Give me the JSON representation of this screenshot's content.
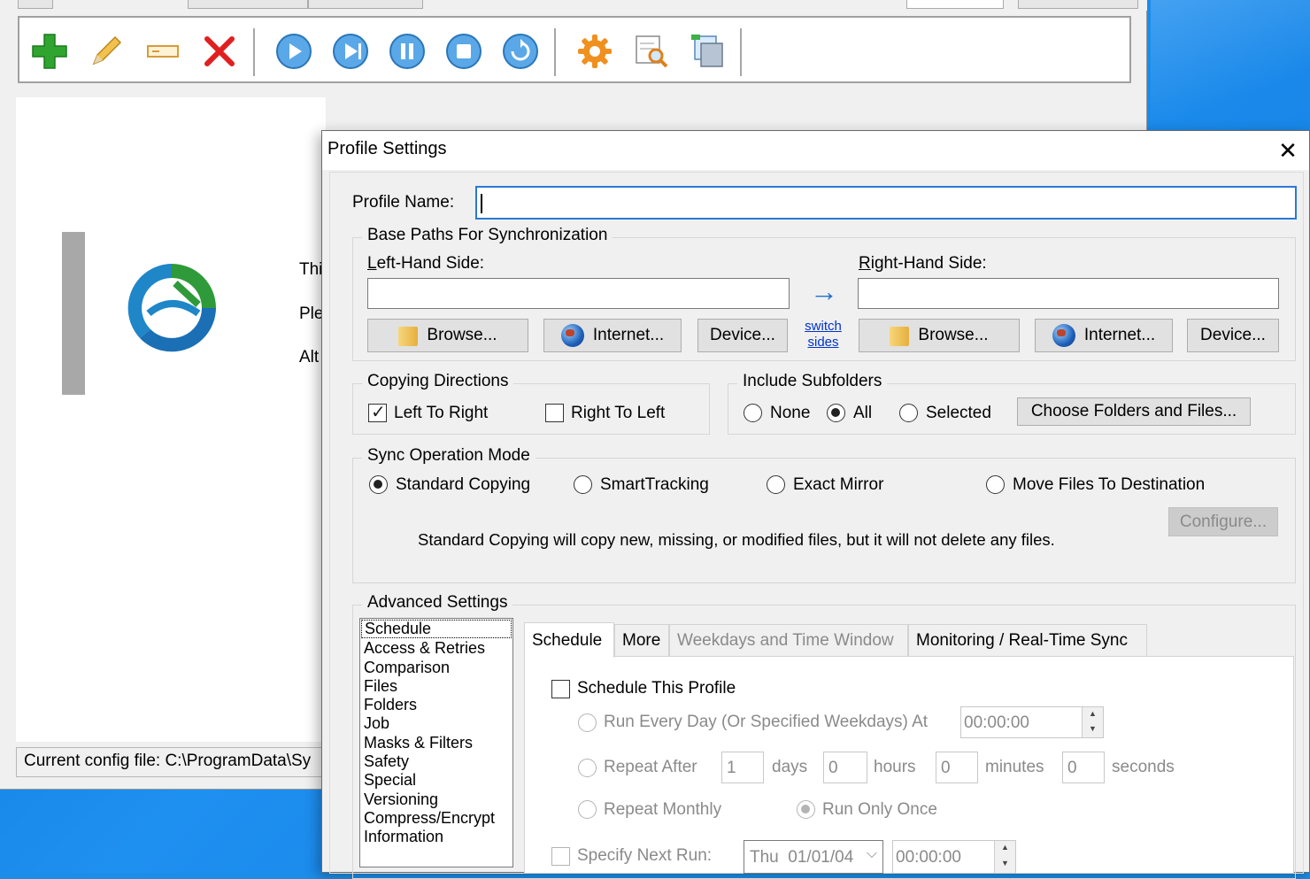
{
  "status": {
    "config_file": "Current config file: C:\\ProgramData\\Sy"
  },
  "background_text": {
    "line1": "Thi",
    "line2": "Ple",
    "line3": "Alt"
  },
  "toolbar": {
    "icons": [
      "add-icon",
      "edit-icon",
      "rename-icon",
      "delete-icon",
      "run-icon",
      "run-attended-icon",
      "pause-icon",
      "stop-icon",
      "restore-icon",
      "settings-icon",
      "analyze-icon",
      "copy-profile-icon"
    ]
  },
  "dialog": {
    "title": "Profile Settings",
    "close_glyph": "✕",
    "profile_name_label": "Profile Name:",
    "profile_name_value": "",
    "base_paths": {
      "title": "Base Paths For Synchronization",
      "left_label_mnemonic": "L",
      "left_label_rest": "eft-Hand Side:",
      "right_label_mnemonic": "R",
      "right_label_rest": "ight-Hand Side:",
      "left_value": "",
      "right_value": "",
      "browse": "Browse...",
      "internet": "Internet...",
      "device": "Device...",
      "arrow": "→",
      "switch_line1": "switch",
      "switch_line2": "sides"
    },
    "copying_directions": {
      "title": "Copying Directions",
      "left_to_right": "Left To Right",
      "left_to_right_checked": true,
      "right_to_left": "Right To Left",
      "right_to_left_checked": false
    },
    "subfolders": {
      "title": "Include Subfolders",
      "options": [
        "None",
        "All",
        "Selected"
      ],
      "selected": "All",
      "choose_button": "Choose Folders and Files..."
    },
    "sync_mode": {
      "title": "Sync Operation Mode",
      "options": [
        "Standard Copying",
        "SmartTracking",
        "Exact Mirror",
        "Move Files To Destination"
      ],
      "selected": "Standard Copying",
      "configure_button": "Configure...",
      "description": "Standard Copying will copy new, missing, or modified files, but it will not delete any files."
    },
    "advanced": {
      "title": "Advanced Settings",
      "categories": [
        "Schedule",
        "Access & Retries",
        "Comparison",
        "Files",
        "Folders",
        "Job",
        "Masks & Filters",
        "Safety",
        "Special",
        "Versioning",
        "Compress/Encrypt",
        "Information"
      ],
      "selected_category": "Schedule",
      "tabs": [
        "Schedule",
        "More",
        "Weekdays and Time Window",
        "Monitoring / Real-Time Sync"
      ],
      "active_tab": "Schedule",
      "schedule": {
        "schedule_this_profile": "Schedule This Profile",
        "run_every_day": "Run Every Day (Or Specified Weekdays) At",
        "run_every_day_time": "00:00:00",
        "repeat_after": "Repeat After",
        "days_value": "1",
        "days_label": "days",
        "hours_value": "0",
        "hours_label": "hours",
        "minutes_value": "0",
        "minutes_label": "minutes",
        "seconds_value": "0",
        "seconds_label": "seconds",
        "repeat_monthly": "Repeat Monthly",
        "run_only_once": "Run Only Once",
        "specify_next_run": "Specify Next Run:",
        "next_run_date": "Thu  01/01/04",
        "next_run_time": "00:00:00"
      }
    }
  },
  "colors": {
    "desktop": "#1c8ee8",
    "focus_border": "#2a78d6",
    "link": "#0033cc",
    "delete_red": "#e02020",
    "add_green": "#2fa52f",
    "play_blue": "#2a84cf",
    "gear_orange": "#f0901e"
  }
}
